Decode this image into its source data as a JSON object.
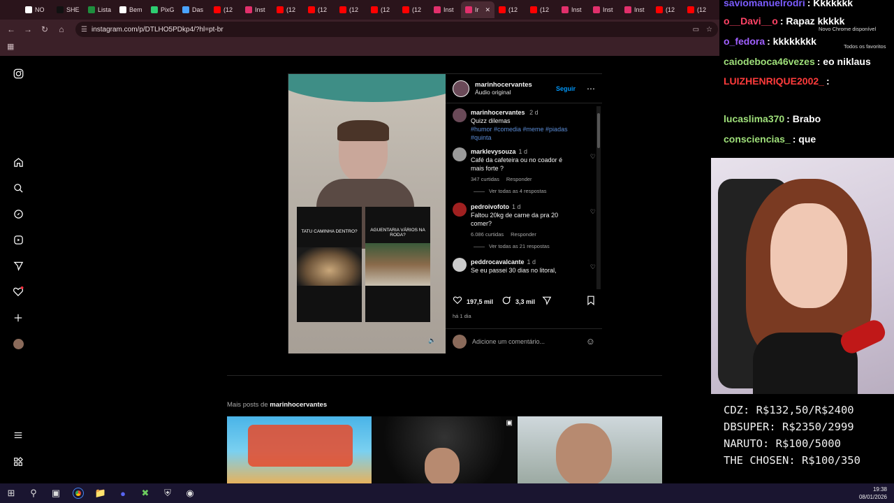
{
  "browser": {
    "tabs": [
      {
        "label": "NO",
        "color": "#ffffff"
      },
      {
        "label": "SHE",
        "color": "#111111"
      },
      {
        "label": "Lista",
        "color": "#1e8e3e"
      },
      {
        "label": "Bem",
        "color": "#ffffff"
      },
      {
        "label": "PixG",
        "color": "#2ecc71"
      },
      {
        "label": "Das",
        "color": "#4aa3ff"
      },
      {
        "label": "(12",
        "color": "#ff0000"
      },
      {
        "label": "Inst",
        "color": "#e1306c"
      },
      {
        "label": "(12",
        "color": "#ff0000"
      },
      {
        "label": "(12",
        "color": "#ff0000"
      },
      {
        "label": "(12",
        "color": "#ff0000"
      },
      {
        "label": "(12",
        "color": "#ff0000"
      },
      {
        "label": "(12",
        "color": "#ff0000"
      },
      {
        "label": "Inst",
        "color": "#e1306c"
      },
      {
        "label": "Ir",
        "color": "#e1306c",
        "active": true
      },
      {
        "label": "(12",
        "color": "#ff0000"
      },
      {
        "label": "(12",
        "color": "#ff0000"
      },
      {
        "label": "Inst",
        "color": "#e1306c"
      },
      {
        "label": "Inst",
        "color": "#e1306c"
      },
      {
        "label": "Inst",
        "color": "#e1306c"
      },
      {
        "label": "(12",
        "color": "#ff0000"
      },
      {
        "label": "(12",
        "color": "#ff0000"
      }
    ],
    "url": "instagram.com/p/DTLHO5PDkp4/?hl=pt-br",
    "new_chrome": "Novo Chrome disponível",
    "favorites": "Todos os favoritos"
  },
  "post": {
    "username": "marinhocervantes",
    "audio": "Áudio original",
    "follow_label": "Seguir",
    "caption_user": "marinhocervantes",
    "caption_time": "2 d",
    "caption_text": "Quizz dilemas",
    "caption_tags": "#humor #comedia #meme #piadas #quinta",
    "quiz_left": "TATU CAMINHA DENTRO?",
    "quiz_right": "AGUENTARIA VÁRIOS NA RODA?",
    "likes": "197,5 mil",
    "comments_count": "3,3 mil",
    "posted": "há 1 dia",
    "add_comment": "Adicione um comentário...",
    "more_posts_prefix": "Mais posts de",
    "more_posts_user": "marinhocervantes"
  },
  "comments": [
    {
      "user": "marklevysouza",
      "time": "1 d",
      "text": "Café da cafeteira ou no coador é mais forte ?",
      "likes": "347 curtidas",
      "reply": "Responder",
      "see": "Ver todas as 4 respostas",
      "color": "#9a9a9a"
    },
    {
      "user": "pedroivofoto",
      "time": "1 d",
      "text": "Faltou 20kg de carne da pra 20 comer?",
      "likes": "6.086 curtidas",
      "reply": "Responder",
      "see": "Ver todas as 21 respostas",
      "color": "#a02020"
    },
    {
      "user": "peddrocavalcante",
      "time": "1 d",
      "text": "Se eu passei 30 dias no litoral,",
      "likes": "",
      "reply": "",
      "see": "",
      "color": "#cccccc"
    }
  ],
  "chat": [
    {
      "user": "saviomanuelrodri",
      "msg": ": Kkkkkkk",
      "color": "#7b5cff"
    },
    {
      "user": "o__Davi__o",
      "msg": ": Rapaz kkkkk",
      "color": "#ff4466"
    },
    {
      "user": "o_fedora",
      "msg": ": kkkkkkkk",
      "color": "#a060ff"
    },
    {
      "user": "caiodeboca46vezes",
      "msg": ": eo niklaus",
      "color": "#9fe07a"
    },
    {
      "user": "LUIZHENRIQUE2002_",
      "msg": ":",
      "color": "#ff3b3b"
    },
    {
      "user": "lucaslima370",
      "msg": ": Brabo",
      "color": "#9fe07a"
    },
    {
      "user": "consciencias_",
      "msg": ": que",
      "color": "#9fe07a"
    }
  ],
  "goals": [
    "CDZ: R$132,50/R$2400",
    "DBSUPER: R$2350/2999",
    "NARUTO: R$100/5000",
    "THE CHOSEN: R$100/350"
  ],
  "taskbar": {
    "time": "19:38",
    "date": "08/01/2026"
  }
}
